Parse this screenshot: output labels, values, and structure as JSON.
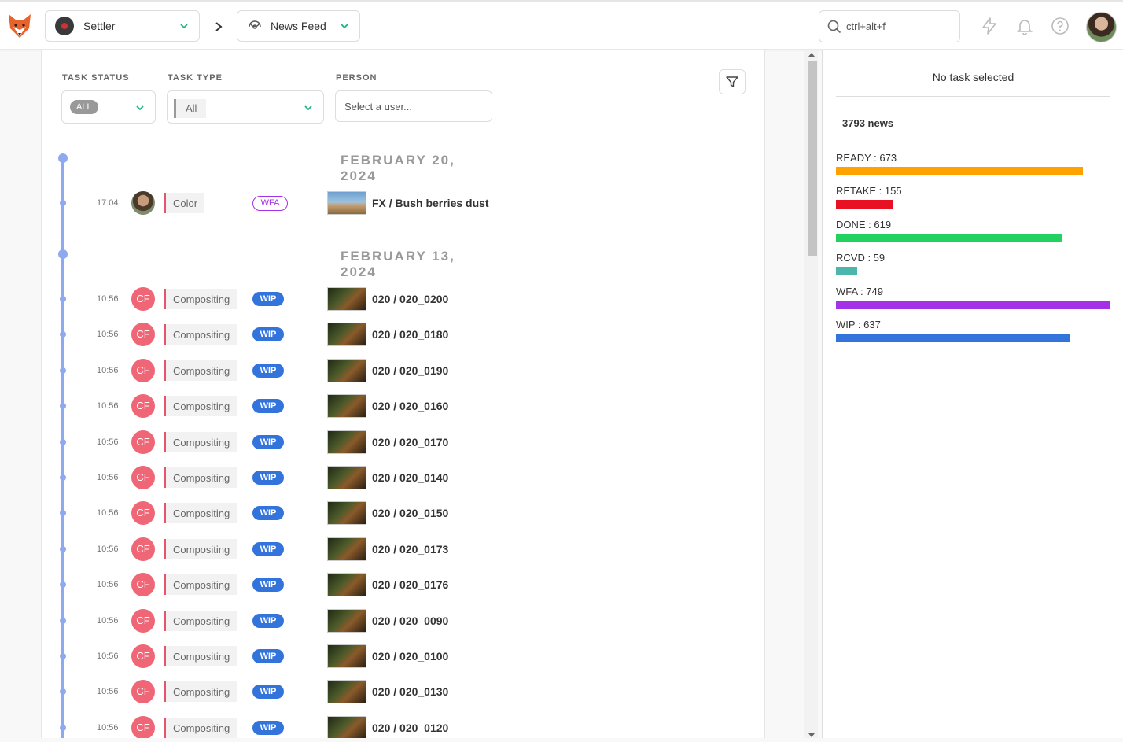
{
  "header": {
    "production": "Settler",
    "section": "News Feed",
    "search_placeholder": "ctrl+alt+f"
  },
  "filters": {
    "task_status_label": "TASK STATUS",
    "task_status_value": "ALL",
    "task_type_label": "TASK TYPE",
    "task_type_value": "All",
    "person_label": "PERSON",
    "person_placeholder": "Select a user..."
  },
  "groups": [
    {
      "date": "FEBRUARY 20, 2024",
      "items": [
        {
          "time": "17:04",
          "avatar": "",
          "task_type": "Color",
          "status": "WFA",
          "entity": "FX / Bush berries dust"
        }
      ]
    },
    {
      "date": "FEBRUARY 13, 2024",
      "items": [
        {
          "time": "10:56",
          "avatar": "CF",
          "task_type": "Compositing",
          "status": "WIP",
          "entity": "020 / 020_0200"
        },
        {
          "time": "10:56",
          "avatar": "CF",
          "task_type": "Compositing",
          "status": "WIP",
          "entity": "020 / 020_0180"
        },
        {
          "time": "10:56",
          "avatar": "CF",
          "task_type": "Compositing",
          "status": "WIP",
          "entity": "020 / 020_0190"
        },
        {
          "time": "10:56",
          "avatar": "CF",
          "task_type": "Compositing",
          "status": "WIP",
          "entity": "020 / 020_0160"
        },
        {
          "time": "10:56",
          "avatar": "CF",
          "task_type": "Compositing",
          "status": "WIP",
          "entity": "020 / 020_0170"
        },
        {
          "time": "10:56",
          "avatar": "CF",
          "task_type": "Compositing",
          "status": "WIP",
          "entity": "020 / 020_0140"
        },
        {
          "time": "10:56",
          "avatar": "CF",
          "task_type": "Compositing",
          "status": "WIP",
          "entity": "020 / 020_0150"
        },
        {
          "time": "10:56",
          "avatar": "CF",
          "task_type": "Compositing",
          "status": "WIP",
          "entity": "020 / 020_0173"
        },
        {
          "time": "10:56",
          "avatar": "CF",
          "task_type": "Compositing",
          "status": "WIP",
          "entity": "020 / 020_0176"
        },
        {
          "time": "10:56",
          "avatar": "CF",
          "task_type": "Compositing",
          "status": "WIP",
          "entity": "020 / 020_0090"
        },
        {
          "time": "10:56",
          "avatar": "CF",
          "task_type": "Compositing",
          "status": "WIP",
          "entity": "020 / 020_0100"
        },
        {
          "time": "10:56",
          "avatar": "CF",
          "task_type": "Compositing",
          "status": "WIP",
          "entity": "020 / 020_0130"
        },
        {
          "time": "10:56",
          "avatar": "CF",
          "task_type": "Compositing",
          "status": "WIP",
          "entity": "020 / 020_0120"
        }
      ]
    }
  ],
  "side": {
    "no_task": "No task selected",
    "news_count": "3793 news",
    "stats": [
      {
        "label": "READY : 673",
        "count": 673,
        "color": "#ffa200"
      },
      {
        "label": "RETAKE : 155",
        "count": 155,
        "color": "#e81123"
      },
      {
        "label": "DONE : 619",
        "count": 619,
        "color": "#22d160"
      },
      {
        "label": "RCVD : 59",
        "count": 59,
        "color": "#4db6ac"
      },
      {
        "label": "WFA : 749",
        "count": 749,
        "color": "#a531e6"
      },
      {
        "label": "WIP : 637",
        "count": 637,
        "color": "#3273dc"
      }
    ]
  }
}
